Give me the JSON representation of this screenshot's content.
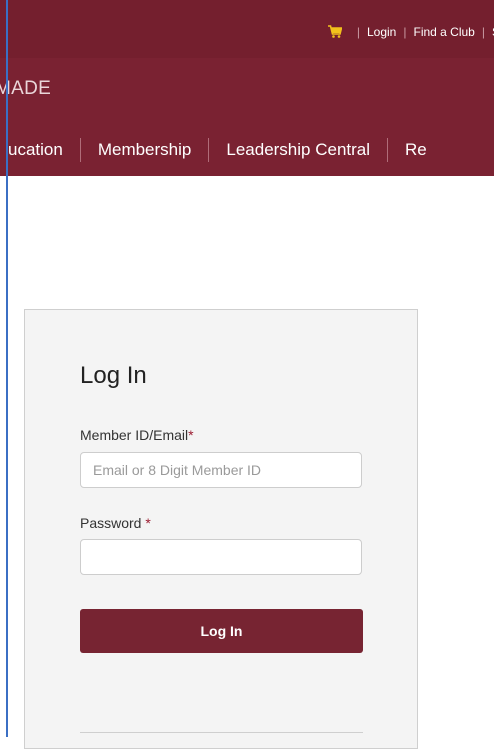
{
  "header": {
    "cart_icon": "cart-icon",
    "links": [
      "Login",
      "Find a Club",
      "S"
    ]
  },
  "brand": {
    "text": "MADE"
  },
  "nav": {
    "items": [
      "ucation",
      "Membership",
      "Leadership Central",
      "Re"
    ]
  },
  "login": {
    "title": "Log In",
    "member_label": "Member ID/Email",
    "member_required": "*",
    "member_placeholder": "Email or 8 Digit Member ID",
    "member_value": "",
    "password_label": "Password ",
    "password_required": "*",
    "password_value": "",
    "submit_label": "Log In"
  },
  "colors": {
    "brand_maroon": "#772432",
    "cart_yellow": "#f2c21b",
    "required_red": "#9b1b30"
  }
}
